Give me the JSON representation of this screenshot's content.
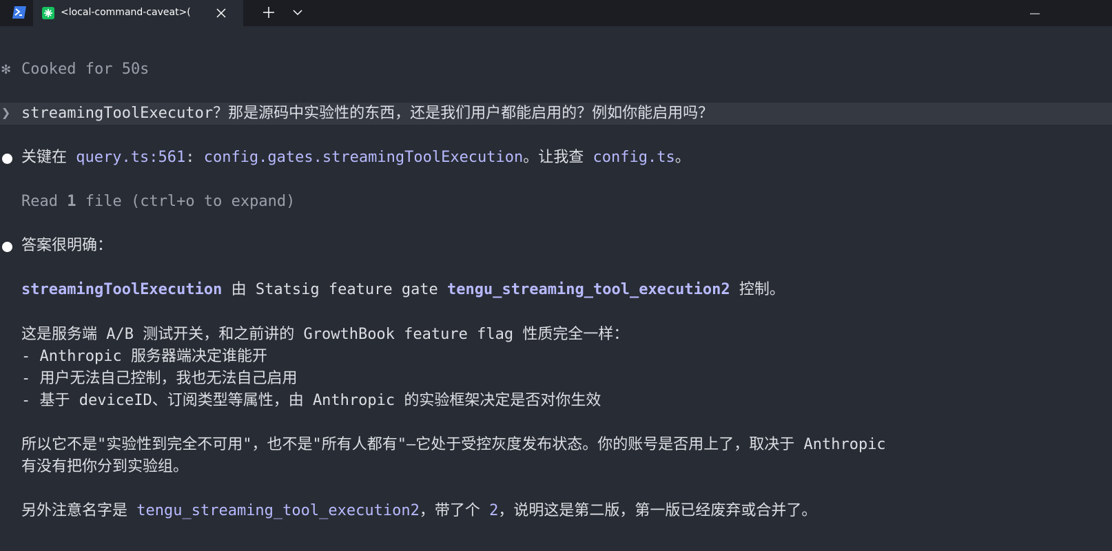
{
  "tabbar": {
    "active_tab_title": "<local-command-caveat>(",
    "new_tab_label": "+",
    "colors": {
      "tab_icon": "#16c060",
      "terminal_icon": "#3b78e7"
    },
    "icons": [
      "powershell-icon",
      "app-icon",
      "close-icon",
      "plus-icon",
      "chevron-down-icon",
      "minimize-icon"
    ]
  },
  "status": {
    "spinner_glyph": "✻",
    "text": "Cooked for 50s"
  },
  "prompt": {
    "glyph": "❯",
    "text": "streamingToolExecutor？那是源码中实验性的东西，还是我们用户都能启用的？例如你能启用吗？"
  },
  "message1": {
    "prefix": "关键在 ",
    "ref1": "query.ts:561",
    "colon": ": ",
    "ref2": "config.gates.streamingToolExecution",
    "mid": "。让我查 ",
    "ref3": "config.ts",
    "end": "。"
  },
  "tool_result": {
    "prefix": "Read ",
    "count": "1",
    "suffix": " file (ctrl+o to expand)"
  },
  "message2": {
    "heading": "答案很明确：",
    "gate_line": {
      "term": "streamingToolExecution",
      "mid": " 由 Statsig feature gate ",
      "gate": "tengu_streaming_tool_execution2",
      "end": " 控制。"
    },
    "para1": "这是服务端 A/B 测试开关，和之前讲的 GrowthBook feature flag 性质完全一样：",
    "bullets": [
      "- Anthropic 服务器端决定谁能开",
      "- 用户无法自己控制，我也无法自己启用",
      "- 基于 deviceID、订阅类型等属性，由 Anthropic 的实验框架决定是否对你生效"
    ],
    "para2_line1": "所以它不是\"实验性到完全不可用\"，也不是\"所有人都有\"—它处于受控灰度发布状态。你的账号是否用上了，取决于 Anthropic",
    "para2_line2": "有没有把你分到实验组。",
    "para3": {
      "prefix": "另外注意名字是 ",
      "name": "tengu_streaming_tool_execution2",
      "mid": "，带了个 ",
      "num": "2",
      "end": "，说明这是第二版，第一版已经废弃或合并了。"
    }
  }
}
